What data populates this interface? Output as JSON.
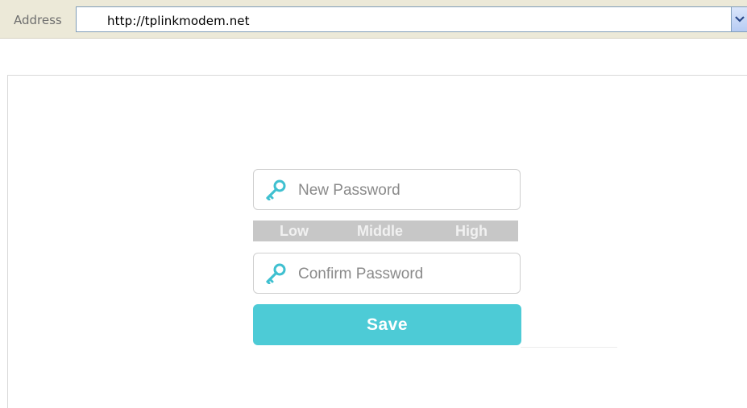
{
  "address_bar": {
    "label": "Address",
    "url": "http://tplinkmodem.net",
    "dropdown_icon": "chevron-down-icon"
  },
  "form": {
    "new_password_placeholder": "New Password",
    "confirm_password_placeholder": "Confirm Password",
    "field_icon": "key-icon",
    "strength_labels": {
      "low": "Low",
      "middle": "Middle",
      "high": "High"
    },
    "save_label": "Save"
  },
  "colors": {
    "accent": "#4dcbd6",
    "strength_bar": "#c7c7c7",
    "placeholder": "#8a8a8a"
  }
}
